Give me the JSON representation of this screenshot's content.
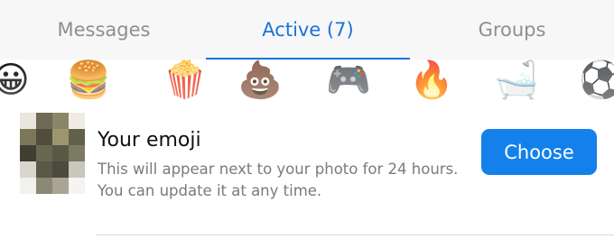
{
  "tabs": [
    {
      "label": "Messages",
      "active": false
    },
    {
      "label": "Active (7)",
      "active": true
    },
    {
      "label": "Groups",
      "active": false
    }
  ],
  "emoji_strip": [
    {
      "icon": "grinning-face",
      "glyph": "😀"
    },
    {
      "icon": "hamburger",
      "glyph": "🍔"
    },
    {
      "icon": "popcorn",
      "glyph": "🍿"
    },
    {
      "icon": "pile-of-poo",
      "glyph": "💩"
    },
    {
      "icon": "video-game-controller",
      "glyph": "🎮"
    },
    {
      "icon": "fire",
      "glyph": "🔥"
    },
    {
      "icon": "bathtub",
      "glyph": "🛁"
    },
    {
      "icon": "soccer-ball",
      "glyph": "⚽"
    }
  ],
  "status": {
    "title": "Your emoji",
    "description": "This will appear next to your photo for 24 hours. You can update it at any time.",
    "button_label": "Choose"
  },
  "colors": {
    "accent": "#1a73d9",
    "button": "#1380ec",
    "tab_inactive": "#8e8e93",
    "description": "#7a7a7f"
  }
}
